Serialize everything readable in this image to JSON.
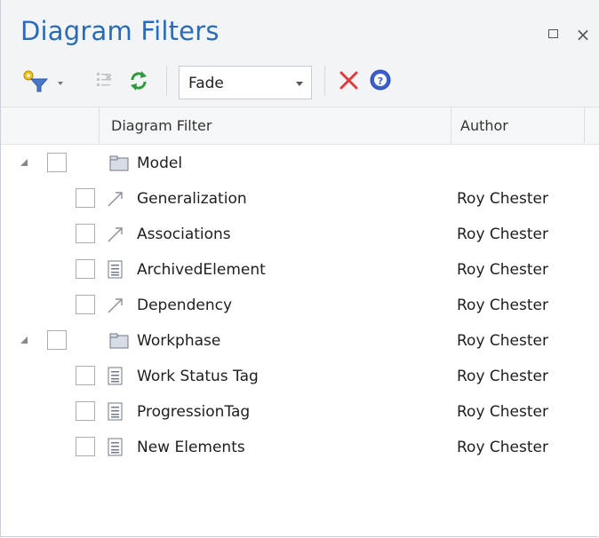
{
  "window": {
    "title": "Diagram Filters",
    "close_glyph": "×"
  },
  "toolbar": {
    "mode_value": "Fade"
  },
  "columns": {
    "filter": "Diagram Filter",
    "author": "Author"
  },
  "rows": [
    {
      "label": "Model",
      "author": "",
      "icon": "folder-icon",
      "level": 0
    },
    {
      "label": "Generalization",
      "author": "Roy Chester",
      "icon": "connector-icon",
      "level": 1
    },
    {
      "label": "Associations",
      "author": "Roy Chester",
      "icon": "connector-icon",
      "level": 1
    },
    {
      "label": "ArchivedElement",
      "author": "Roy Chester",
      "icon": "element-filter-icon",
      "level": 1
    },
    {
      "label": "Dependency",
      "author": "Roy Chester",
      "icon": "connector-icon",
      "level": 1
    },
    {
      "label": "Workphase",
      "author": "Roy Chester",
      "icon": "folder-icon",
      "level": 0
    },
    {
      "label": "Work Status Tag",
      "author": "Roy Chester",
      "icon": "element-filter-icon",
      "level": 1
    },
    {
      "label": "ProgressionTag",
      "author": "Roy Chester",
      "icon": "element-filter-icon",
      "level": 1
    },
    {
      "label": "New Elements",
      "author": "Roy Chester",
      "icon": "element-filter-icon",
      "level": 1
    }
  ],
  "colors": {
    "title": "#2b6bb5",
    "delete_red": "#e03b3b",
    "help_blue": "#3b5fd1",
    "refresh_green": "#2e9a3a"
  }
}
